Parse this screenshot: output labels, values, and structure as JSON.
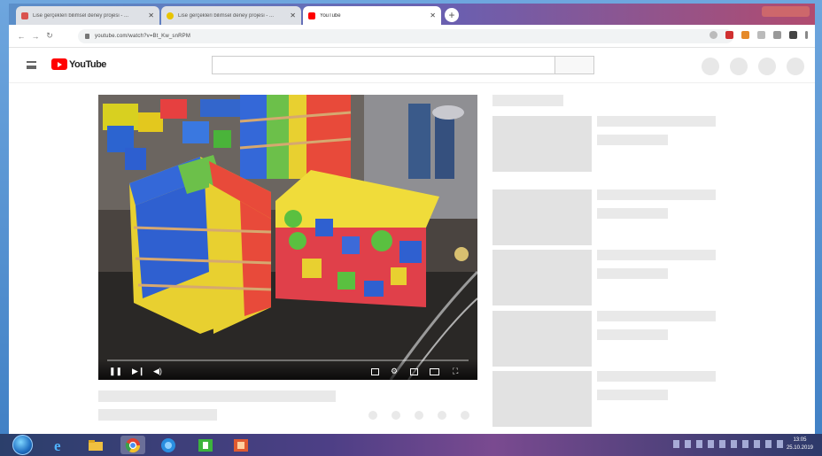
{
  "browser": {
    "tabs": [
      {
        "label": "Lise gerçekleri bilimsel deney projesi - ...",
        "fav_color": "#d9534f",
        "active": false
      },
      {
        "label": "Lise gerçekleri bilimsel deney projesi - ...",
        "fav_color": "#e8c400",
        "active": false
      },
      {
        "label": "YouTube",
        "fav_color": "#ff0000",
        "active": true
      }
    ],
    "new_tab_glyph": "+",
    "close_glyph": "✕",
    "url": "youtube.com/watch?v=Bt_Kw_snRPM"
  },
  "youtube": {
    "logo_text": "YouTube",
    "brand_color": "#ff0000"
  },
  "player": {
    "play_glyph": "❚❚",
    "next_glyph": "▶❙",
    "volume_glyph": "◀)",
    "settings_glyph": "⚙",
    "fullscreen_glyph": "⛶"
  },
  "taskbar": {
    "clock_time": "13:05",
    "clock_date": "25.10.2019"
  }
}
